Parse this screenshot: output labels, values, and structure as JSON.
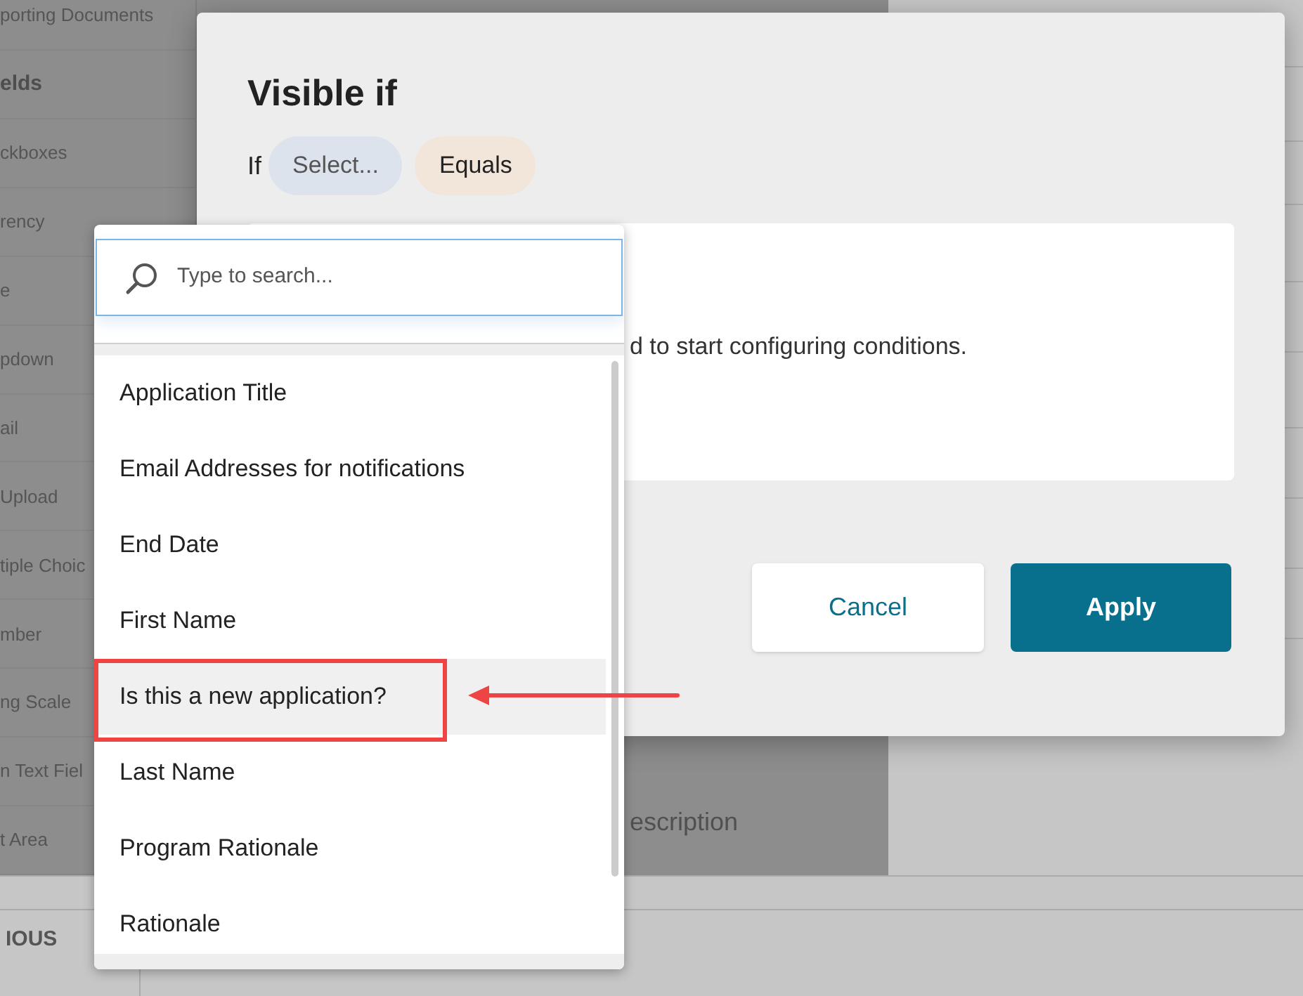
{
  "sidebar": {
    "items": [
      {
        "label": "porting Documents",
        "kind": "item"
      },
      {
        "label": "elds",
        "kind": "heading"
      },
      {
        "label": "ckboxes",
        "kind": "item"
      },
      {
        "label": "rency",
        "kind": "item"
      },
      {
        "label": "e",
        "kind": "item"
      },
      {
        "label": "pdown",
        "kind": "item"
      },
      {
        "label": "ail",
        "kind": "item"
      },
      {
        "label": "Upload",
        "kind": "item"
      },
      {
        "label": "tiple Choic",
        "kind": "item"
      },
      {
        "label": "mber",
        "kind": "item"
      },
      {
        "label": "ng Scale",
        "kind": "item"
      },
      {
        "label": "n Text Fiel",
        "kind": "item"
      },
      {
        "label": "t Area",
        "kind": "item"
      }
    ]
  },
  "background_field_label": "escription",
  "footer": {
    "button": "IOUS"
  },
  "dialog": {
    "title": "Visible if",
    "if_label": "If",
    "field_pill": "Select...",
    "operator_pill": "Equals",
    "empty_message": "d to start configuring conditions.",
    "buttons": [
      {
        "label": "Cancel",
        "kind": "secondary"
      },
      {
        "label": "Apply",
        "kind": "primary"
      }
    ]
  },
  "dropdown": {
    "search": {
      "placeholder": "Type to search..."
    },
    "items": [
      {
        "label": "Application Title",
        "highlighted": false
      },
      {
        "label": "Email Addresses for notifications",
        "highlighted": false
      },
      {
        "label": "End Date",
        "highlighted": false
      },
      {
        "label": "First Name",
        "highlighted": false
      },
      {
        "label": "Is this a new application?",
        "highlighted": true
      },
      {
        "label": "Last Name",
        "highlighted": false
      },
      {
        "label": "Program Rationale",
        "highlighted": false
      },
      {
        "label": "Rationale",
        "highlighted": false
      }
    ]
  }
}
